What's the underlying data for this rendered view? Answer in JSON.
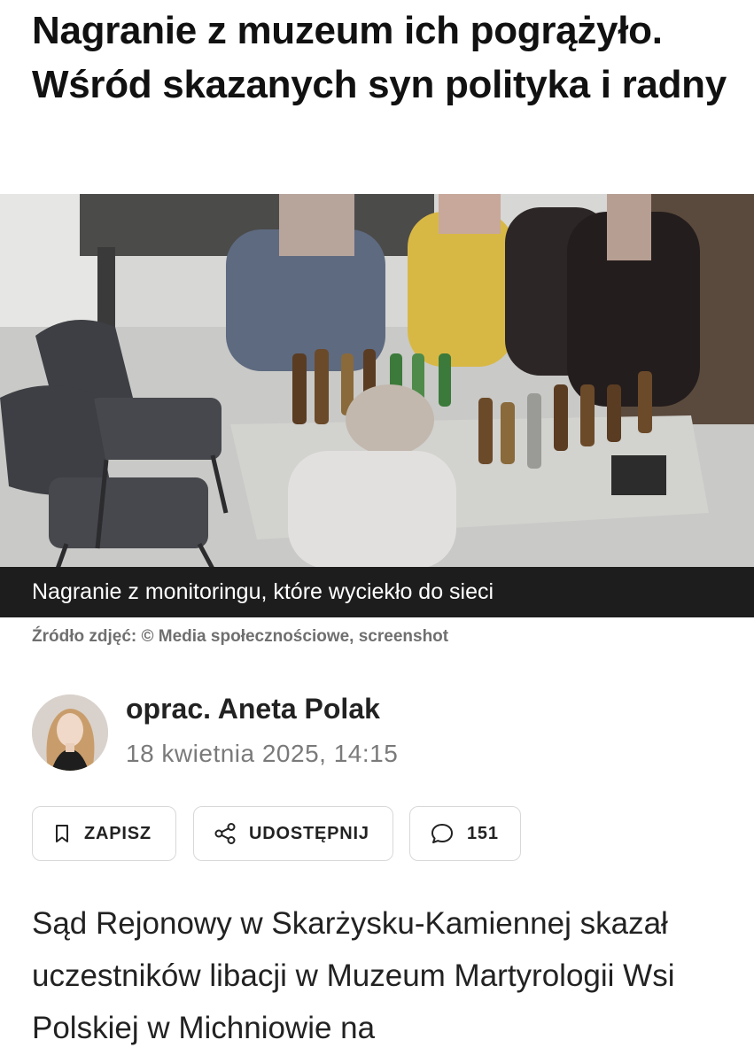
{
  "article": {
    "headline": "Nagranie z muzeum ich pogrążyło. Wśród skazanych syn polityka i radny",
    "photo_caption": "Nagranie z monitoringu, które wyciekło do sieci",
    "photo_source": "Źródło zdjęć: © Media społecznościowe, screenshot",
    "author": "oprac. Aneta Polak",
    "date": "18 kwietnia 2025, 14:15",
    "lead": "Sąd Rejonowy w Skarżysku-Kamiennej skazał uczestników libacji w Muzeum Martyrologii Wsi Polskiej w Michniowie na"
  },
  "actions": {
    "save_label": "ZAPISZ",
    "share_label": "UDOSTĘPNIJ",
    "comments_count": "151"
  },
  "icons": {
    "save": "bookmark-icon",
    "share": "share-icon",
    "comments": "comment-bubble-icon"
  },
  "colors": {
    "caption_bar": "#1d1d1d",
    "source_text": "#6f6f6f",
    "date_text": "#7a7a7a",
    "button_border": "#d8d8d8"
  }
}
